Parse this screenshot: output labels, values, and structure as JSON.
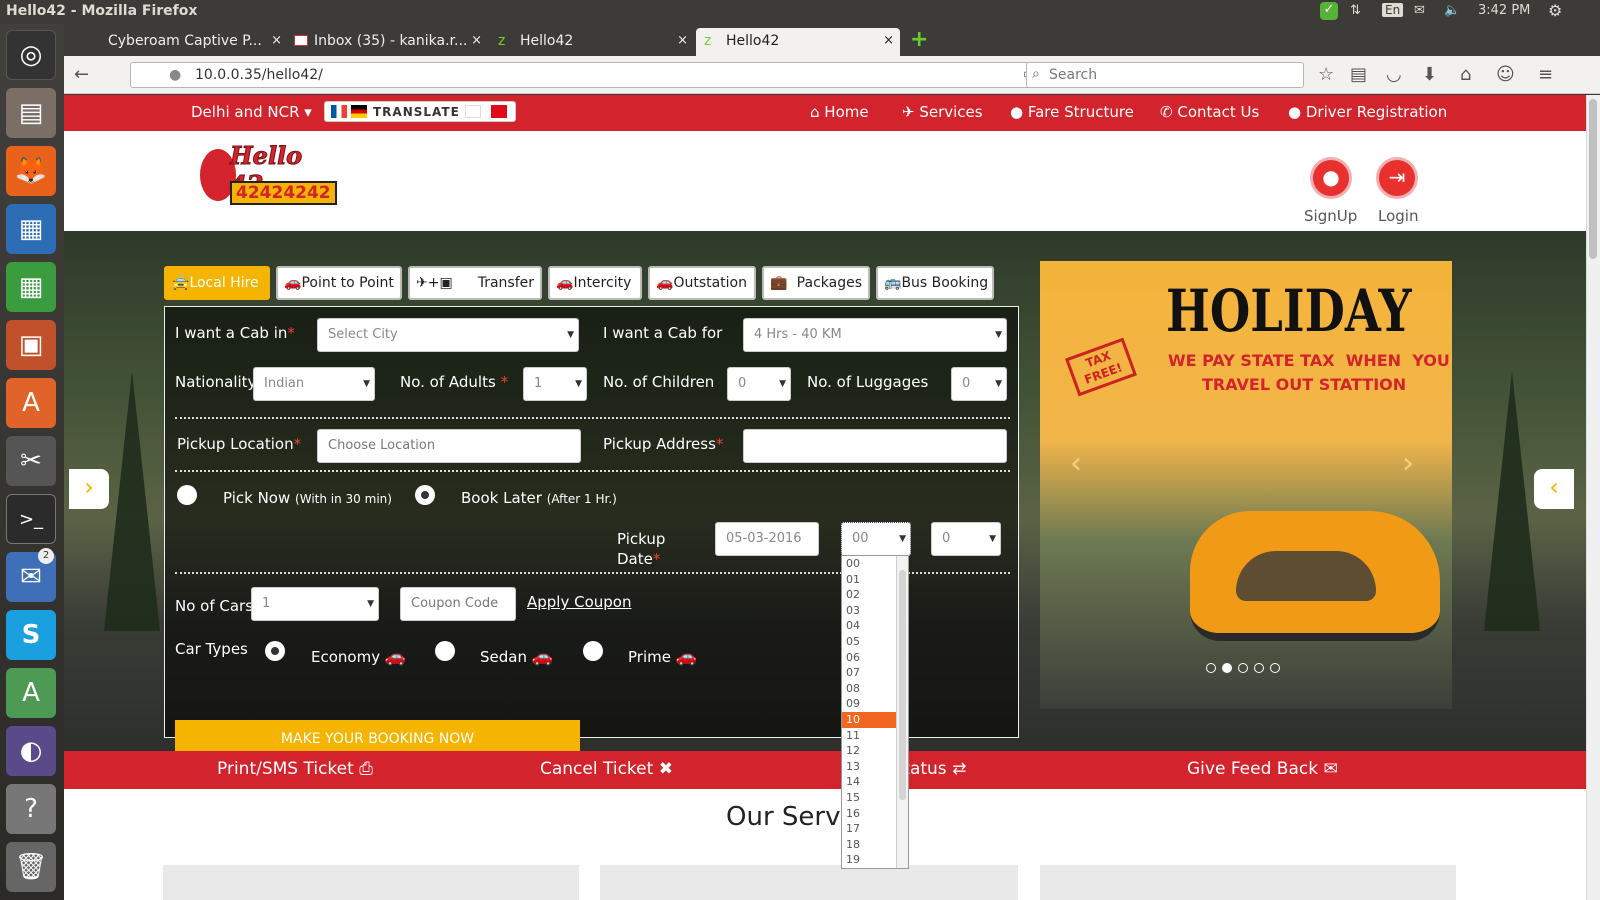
{
  "system": {
    "window_title": "Hello42 - Mozilla Firefox",
    "keyboard": "En",
    "time": "3:42 PM"
  },
  "launcher": {
    "badge_count": "2"
  },
  "browser": {
    "tabs": [
      {
        "label": "Cyberoam Captive P...",
        "close": "×"
      },
      {
        "label": "Inbox (35) - kanika.r...",
        "close": "×"
      },
      {
        "label": "Hello42",
        "close": "×"
      },
      {
        "label": "Hello42",
        "close": "×"
      }
    ],
    "new_tab": "+",
    "url": "10.0.0.35/hello42/",
    "search_placeholder": "Search"
  },
  "site": {
    "city_selector": "Delhi and NCR ▾",
    "translate": "TRANSLATE",
    "nav": [
      "Home",
      "Services",
      "Fare Structure",
      "Contact Us",
      "Driver Registration"
    ],
    "logo": {
      "name": "Hello 42",
      "phone": "42424242"
    },
    "signup": "SignUp",
    "login": "Login",
    "booking_tabs": [
      "Local Hire",
      "Point to Point",
      "Transfer",
      "Intercity",
      "Outstation",
      "Packages",
      "Bus Booking"
    ],
    "form": {
      "cab_in_label": "I want a Cab in",
      "cab_in_value": "Select City",
      "cab_for_label": "I want a Cab for",
      "cab_for_value": "4 Hrs - 40 KM",
      "nationality_label": "Nationality",
      "nationality_value": "Indian",
      "adults_label": "No. of Adults",
      "adults_value": "1",
      "children_label": "No. of Children",
      "children_value": "0",
      "luggages_label": "No. of Luggages",
      "luggages_value": "0",
      "pickup_location_label": "Pickup Location",
      "pickup_location_placeholder": "Choose Location",
      "pickup_address_label": "Pickup Address",
      "pick_now_label": "Pick Now",
      "pick_now_note": "(With in 30 min)",
      "book_later_label": "Book Later",
      "book_later_note": "(After 1 Hr.)",
      "pickup_date_label": "Pickup",
      "pickup_date_label2": "Date",
      "pickup_date_value": "05-03-2016",
      "hour_value": "00",
      "minute_value": "0",
      "cars_label": "No of Cars",
      "cars_value": "1",
      "coupon_placeholder": "Coupon Code",
      "apply_coupon": "Apply Coupon",
      "car_types_label": "Car Types",
      "car_types": [
        "Economy",
        "Sedan",
        "Prime"
      ],
      "submit": "MAKE YOUR BOOKING NOW"
    },
    "promo": {
      "headline": "HOLIDAY",
      "stamp": "TAX FREE!",
      "line1": "WE PAY STATE TAX  WHEN  YOU",
      "line2": "TRAVEL OUT STATTION"
    },
    "bottom_links": [
      "Print/SMS Ticket",
      "Cancel Ticket",
      "Cab Status",
      "Give Feed Back"
    ],
    "services_title": "Our Services"
  },
  "hour_dropdown": {
    "options": [
      "00",
      "01",
      "02",
      "03",
      "04",
      "05",
      "06",
      "07",
      "08",
      "09",
      "10",
      "11",
      "12",
      "13",
      "14",
      "15",
      "16",
      "17",
      "18",
      "19"
    ],
    "highlighted": "10"
  }
}
